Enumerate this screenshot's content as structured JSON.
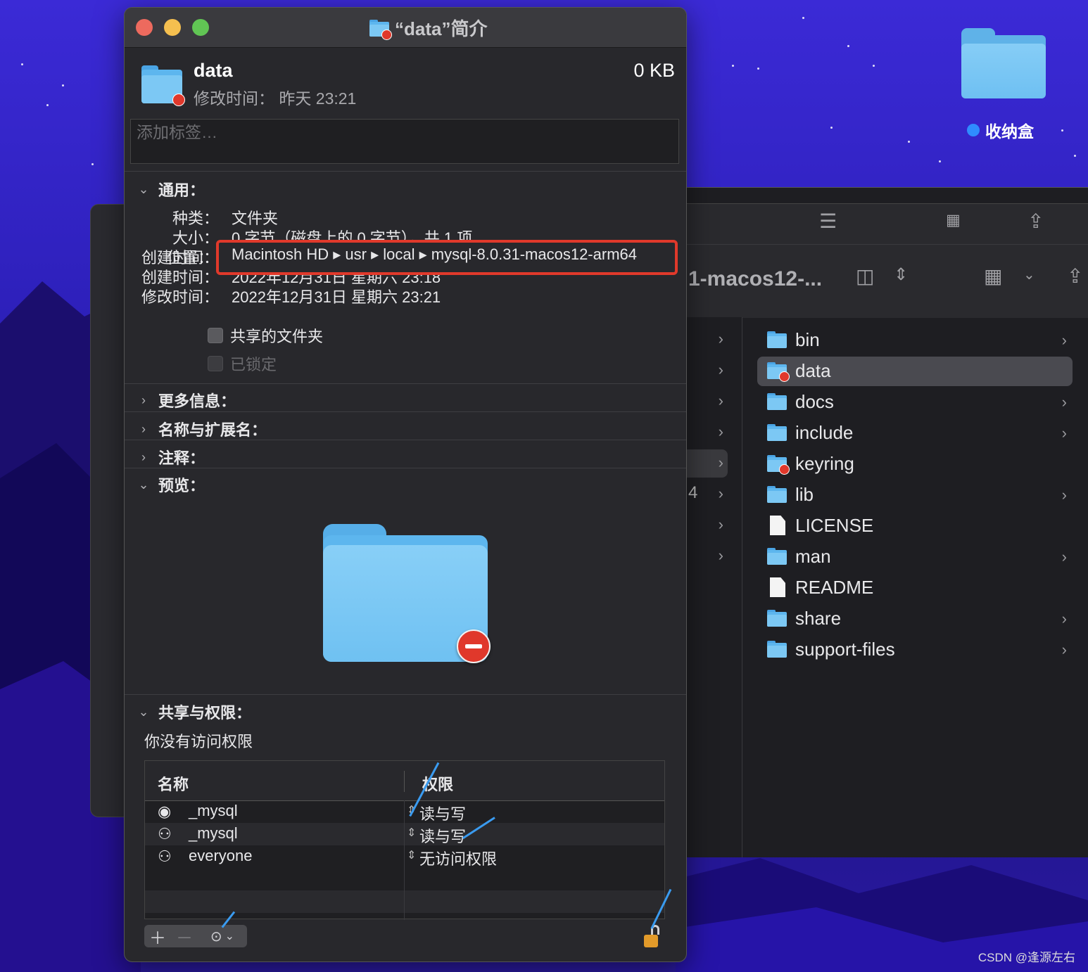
{
  "desktop": {
    "folder_label": "收纳盒",
    "watermark": "CSDN @逢源左右"
  },
  "finder": {
    "path_title": "1-macos12-...",
    "col1_partial_text": "4",
    "files": [
      {
        "name": "bin",
        "kind": "folder",
        "has_children": true,
        "restricted": false,
        "selected": false
      },
      {
        "name": "data",
        "kind": "folder",
        "has_children": false,
        "restricted": true,
        "selected": true
      },
      {
        "name": "docs",
        "kind": "folder",
        "has_children": true,
        "restricted": false,
        "selected": false
      },
      {
        "name": "include",
        "kind": "folder",
        "has_children": true,
        "restricted": false,
        "selected": false
      },
      {
        "name": "keyring",
        "kind": "folder",
        "has_children": false,
        "restricted": true,
        "selected": false
      },
      {
        "name": "lib",
        "kind": "folder",
        "has_children": true,
        "restricted": false,
        "selected": false
      },
      {
        "name": "LICENSE",
        "kind": "document",
        "has_children": false,
        "restricted": false,
        "selected": false
      },
      {
        "name": "man",
        "kind": "folder",
        "has_children": true,
        "restricted": false,
        "selected": false
      },
      {
        "name": "README",
        "kind": "document",
        "has_children": false,
        "restricted": false,
        "selected": false
      },
      {
        "name": "share",
        "kind": "folder",
        "has_children": true,
        "restricted": false,
        "selected": false
      },
      {
        "name": "support-files",
        "kind": "folder",
        "has_children": true,
        "restricted": false,
        "selected": false
      }
    ]
  },
  "info": {
    "window_title": "“data”简介",
    "name": "data",
    "size": "0 KB",
    "modified_short": "修改时间：  昨天 23:21",
    "tags_placeholder": "添加标签…",
    "general": {
      "section_label": "通用：",
      "kind_key": "种类：",
      "kind_value": "文件夹",
      "size_key": "大小：",
      "size_value": "0 字节（磁盘上的 0 字节），共 1 项",
      "where_key": "位置：",
      "where_value": "Macintosh HD ▸ usr ▸ local ▸ mysql-8.0.31-macos12-arm64",
      "created_key": "创建时间：",
      "created_value": "2022年12月31日 星期六 23:18",
      "modified_key": "修改时间：",
      "modified_value": "2022年12月31日 星期六 23:21",
      "shared_folder_label": "共享的文件夹",
      "locked_label": "已锁定"
    },
    "sections": {
      "more_info": "更多信息：",
      "name_ext": "名称与扩展名：",
      "comments": "注释：",
      "preview": "预览：",
      "sharing": "共享与权限："
    },
    "permissions": {
      "notice": "你没有访问权限",
      "col_name": "名称",
      "col_privilege": "权限",
      "rows": [
        {
          "icon": "user-icon",
          "name": "_mysql",
          "privilege": "读与写"
        },
        {
          "icon": "group-icon",
          "name": "_mysql",
          "privilege": "读与写"
        },
        {
          "icon": "everyone-icon",
          "name": "everyone",
          "privilege": "无访问权限"
        }
      ]
    },
    "colors": {
      "highlight_border": "#e0392b",
      "annotation_arrow": "#3a9bf0"
    }
  }
}
